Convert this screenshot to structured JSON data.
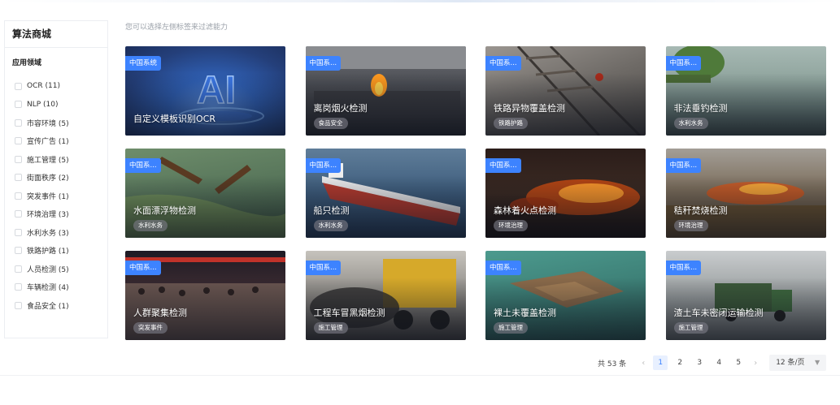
{
  "sidebar": {
    "title": "算法商城",
    "section": "应用领域",
    "items": [
      {
        "label": "OCR (11)"
      },
      {
        "label": "NLP (10)"
      },
      {
        "label": "市容环境 (5)"
      },
      {
        "label": "宣传广告 (1)"
      },
      {
        "label": "施工管理 (5)"
      },
      {
        "label": "街面秩序 (2)"
      },
      {
        "label": "突发事件 (1)"
      },
      {
        "label": "环境治理 (3)"
      },
      {
        "label": "水利水务 (3)"
      },
      {
        "label": "铁路护路 (1)"
      },
      {
        "label": "人员检测 (5)"
      },
      {
        "label": "车辆检测 (4)"
      },
      {
        "label": "食品安全 (1)"
      }
    ]
  },
  "hint": "您可以选择左侧标签来过滤能力",
  "cards": [
    {
      "badge": "中国系统",
      "title": "自定义模板识别OCR",
      "tag": ""
    },
    {
      "badge": "中国系...",
      "title": "离岗烟火检测",
      "tag": "食品安全"
    },
    {
      "badge": "中国系...",
      "title": "铁路异物覆盖检测",
      "tag": "铁路护路"
    },
    {
      "badge": "中国系...",
      "title": "非法垂钓检测",
      "tag": "水利水务"
    },
    {
      "badge": "中国系...",
      "title": "水面漂浮物检测",
      "tag": "水利水务"
    },
    {
      "badge": "中国系...",
      "title": "船只检测",
      "tag": "水利水务"
    },
    {
      "badge": "中国系...",
      "title": "森林着火点检测",
      "tag": "环境治理"
    },
    {
      "badge": "中国系...",
      "title": "秸秆焚烧检测",
      "tag": "环境治理"
    },
    {
      "badge": "中国系...",
      "title": "人群聚集检测",
      "tag": "突发事件"
    },
    {
      "badge": "中国系...",
      "title": "工程车冒黑烟检测",
      "tag": "施工管理"
    },
    {
      "badge": "中国系...",
      "title": "裸土未覆盖检测",
      "tag": "施工管理"
    },
    {
      "badge": "中国系...",
      "title": "渣土车未密闭运输检测",
      "tag": "施工管理"
    }
  ],
  "pagination": {
    "total": "共 53 条",
    "prev": "‹",
    "next": "›",
    "pages": [
      "1",
      "2",
      "3",
      "4",
      "5"
    ],
    "current": "1",
    "page_size": "12 条/页"
  },
  "colors": {
    "accent": "#3d83ff"
  }
}
